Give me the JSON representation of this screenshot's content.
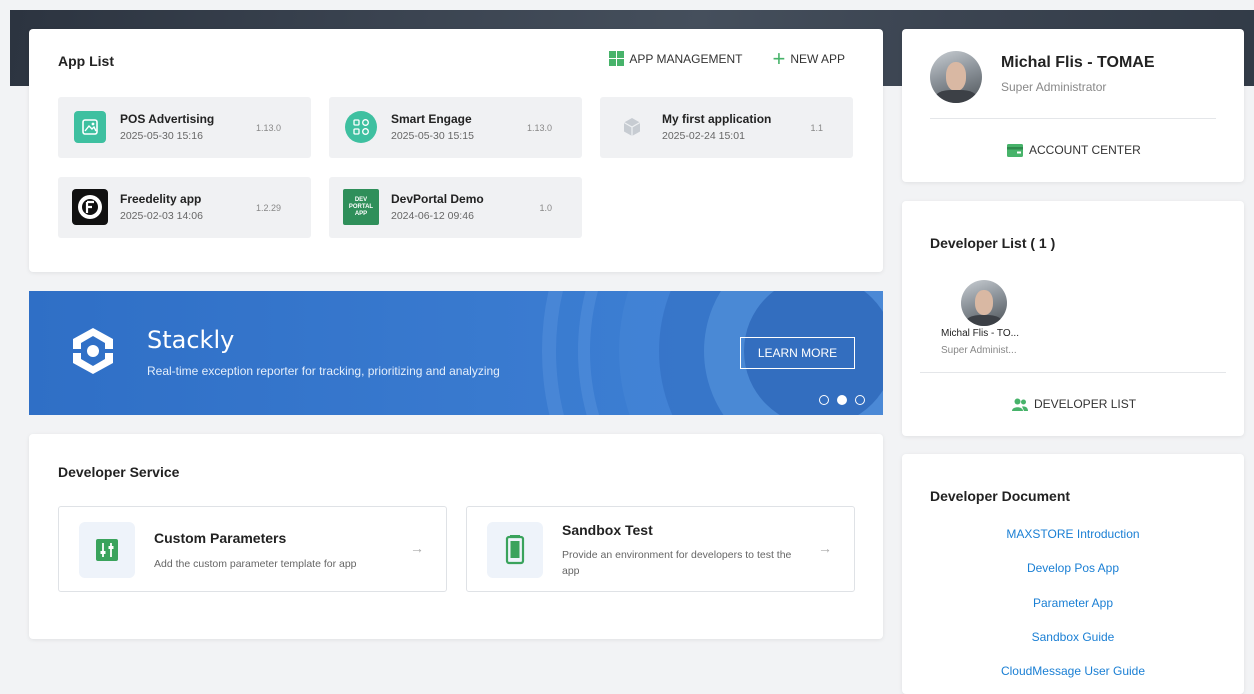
{
  "app_list": {
    "title": "App List",
    "app_management_label": "APP MANAGEMENT",
    "new_app_label": "NEW APP",
    "apps": [
      {
        "name": "POS Advertising",
        "date": "2025-05-30 15:16",
        "version": "1.13.0",
        "icon": "image-icon",
        "color": "#3ec0a0"
      },
      {
        "name": "Smart Engage",
        "date": "2025-05-30 15:15",
        "version": "1.13.0",
        "icon": "engage-icon",
        "color": "#3ec0a0"
      },
      {
        "name": "My first application",
        "date": "2025-02-24 15:01",
        "version": "1.1",
        "icon": "cube-icon",
        "color": "#c7ccd2"
      },
      {
        "name": "Freedelity app",
        "date": "2025-02-03 14:06",
        "version": "1.2.29",
        "icon": "freedelity-logo",
        "color": "#111111"
      },
      {
        "name": "DevPortal Demo",
        "date": "2024-06-12 09:46",
        "version": "1.0",
        "icon": "devportal-logo",
        "color": "#2f8f5a"
      }
    ],
    "devportal_icon_text": [
      "DEV",
      "PORTAL",
      "APP"
    ]
  },
  "banner": {
    "title": "Stackly",
    "subtitle": "Real-time exception reporter for tracking, prioritizing and analyzing",
    "button_label": "LEARN MORE",
    "slides": 3,
    "active_slide": 2
  },
  "developer_service": {
    "title": "Developer Service",
    "items": [
      {
        "name": "Custom Parameters",
        "desc": "Add the custom parameter template for app"
      },
      {
        "name": "Sandbox Test",
        "desc": "Provide an environment for developers to test the app"
      }
    ]
  },
  "profile": {
    "name": "Michal Flis - TOMAE",
    "role": "Super Administrator",
    "account_center_label": "ACCOUNT CENTER"
  },
  "developer_list": {
    "title": "Developer List ( 1 )",
    "developers": [
      {
        "name": "Michal Flis - TO...",
        "role": "Super Administ..."
      }
    ],
    "button_label": "DEVELOPER LIST"
  },
  "developer_document": {
    "title": "Developer Document",
    "links": [
      "MAXSTORE Introduction",
      "Develop Pos App",
      "Parameter App",
      "Sandbox Guide",
      "CloudMessage User Guide"
    ]
  },
  "colors": {
    "accent_green": "#47b36a",
    "link_blue": "#1a7fd4",
    "banner_blue": "#3a7bd0"
  }
}
